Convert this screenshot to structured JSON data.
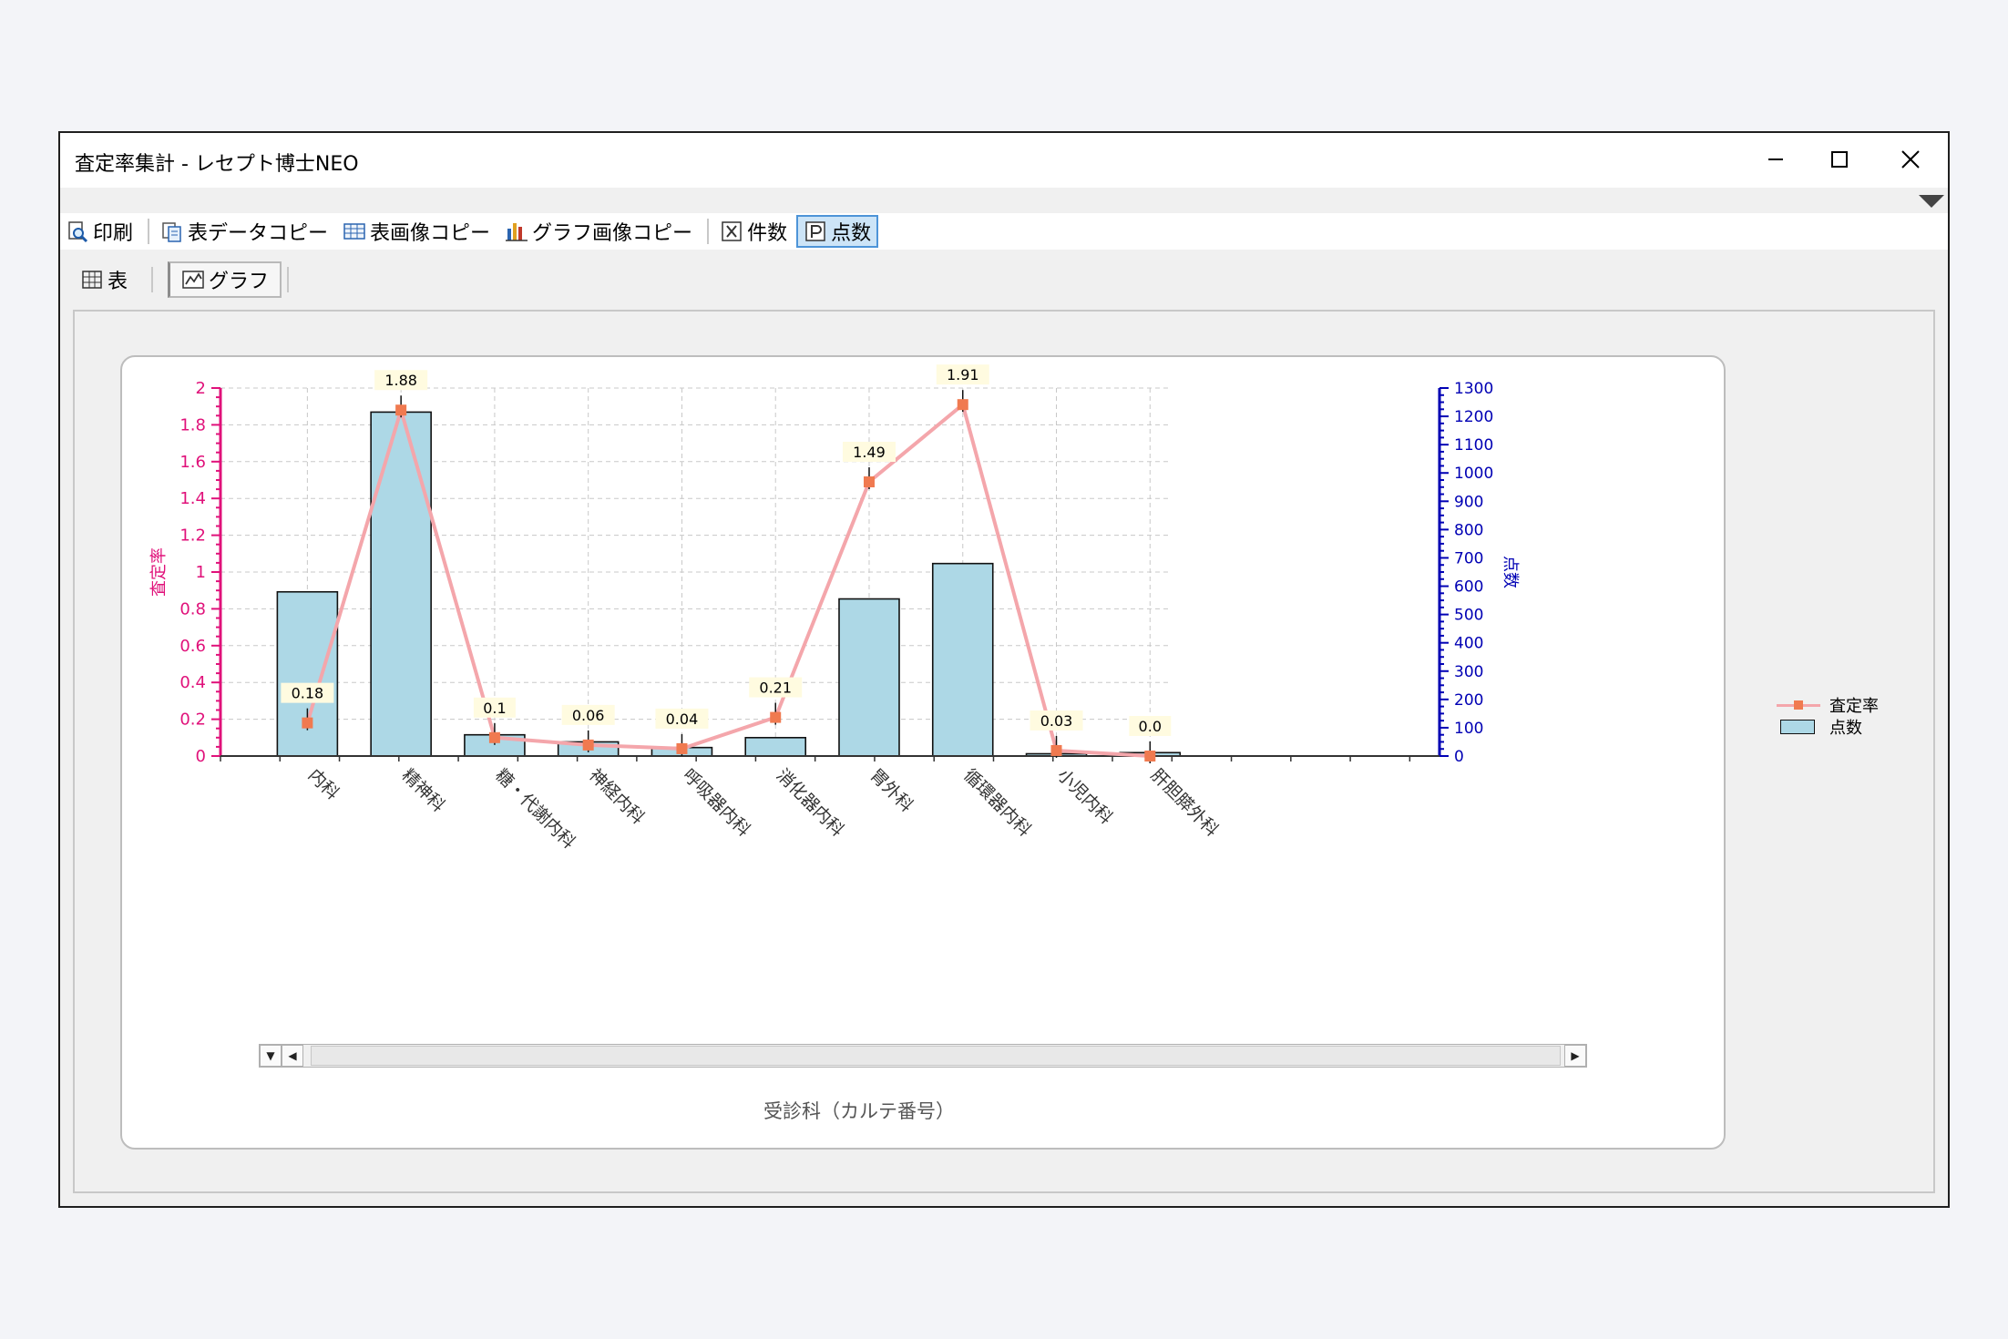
{
  "window": {
    "title": "査定率集計 - レセプト博士NEO",
    "minimize_icon": "minimize-icon",
    "maximize_icon": "maximize-icon",
    "close_icon": "close-icon"
  },
  "toolbar": {
    "print": "印刷",
    "table_data_copy": "表データコピー",
    "table_image_copy": "表画像コピー",
    "graph_image_copy": "グラフ画像コピー",
    "count": "件数",
    "points": "点数",
    "active": "points"
  },
  "tabs": {
    "table": "表",
    "graph": "グラフ",
    "active": "graph"
  },
  "legend": {
    "rate": "査定率",
    "points": "点数"
  },
  "chart_data": {
    "type": "bar",
    "categories": [
      "内科",
      "精神科",
      "糖・代謝内科",
      "神経内科",
      "呼吸器内科",
      "消化器内科",
      "胃外科",
      "循環器内科",
      "小児内科",
      "肝胆膵外科"
    ],
    "xlabel": "受診科（カルテ番号）",
    "ylabel_left": "査定率",
    "ylabel_right": "点数",
    "ylim_left": [
      0,
      2
    ],
    "ylim_right": [
      0,
      1300
    ],
    "yticks_left": [
      "0",
      "0.2",
      "0.4",
      "0.6",
      "0.8",
      "1",
      "1.2",
      "1.4",
      "1.6",
      "1.8",
      "2"
    ],
    "yticks_right": [
      "0",
      "100",
      "200",
      "300",
      "400",
      "500",
      "600",
      "700",
      "800",
      "900",
      "1000",
      "1100",
      "1200",
      "1300"
    ],
    "grid": true,
    "legend_position": "right",
    "series": [
      {
        "name": "点数",
        "type": "bar",
        "axis": "right",
        "color": "#add8e6",
        "values": [
          580,
          1215,
          75,
          50,
          30,
          65,
          555,
          680,
          8,
          12
        ]
      },
      {
        "name": "査定率",
        "type": "line",
        "axis": "left",
        "color": "#f4a6ab",
        "marker_color": "#f07a50",
        "values": [
          0.18,
          1.88,
          0.1,
          0.06,
          0.04,
          0.21,
          1.49,
          1.91,
          0.03,
          0.0
        ],
        "labels": [
          "0.18",
          "1.88",
          "0.1",
          "0.06",
          "0.04",
          "0.21",
          "1.49",
          "1.91",
          "0.03",
          "0.0"
        ]
      }
    ],
    "colors": {
      "left_axis": "#e0117a",
      "right_axis": "#0000b4",
      "grid": "#c8c8c8"
    }
  }
}
